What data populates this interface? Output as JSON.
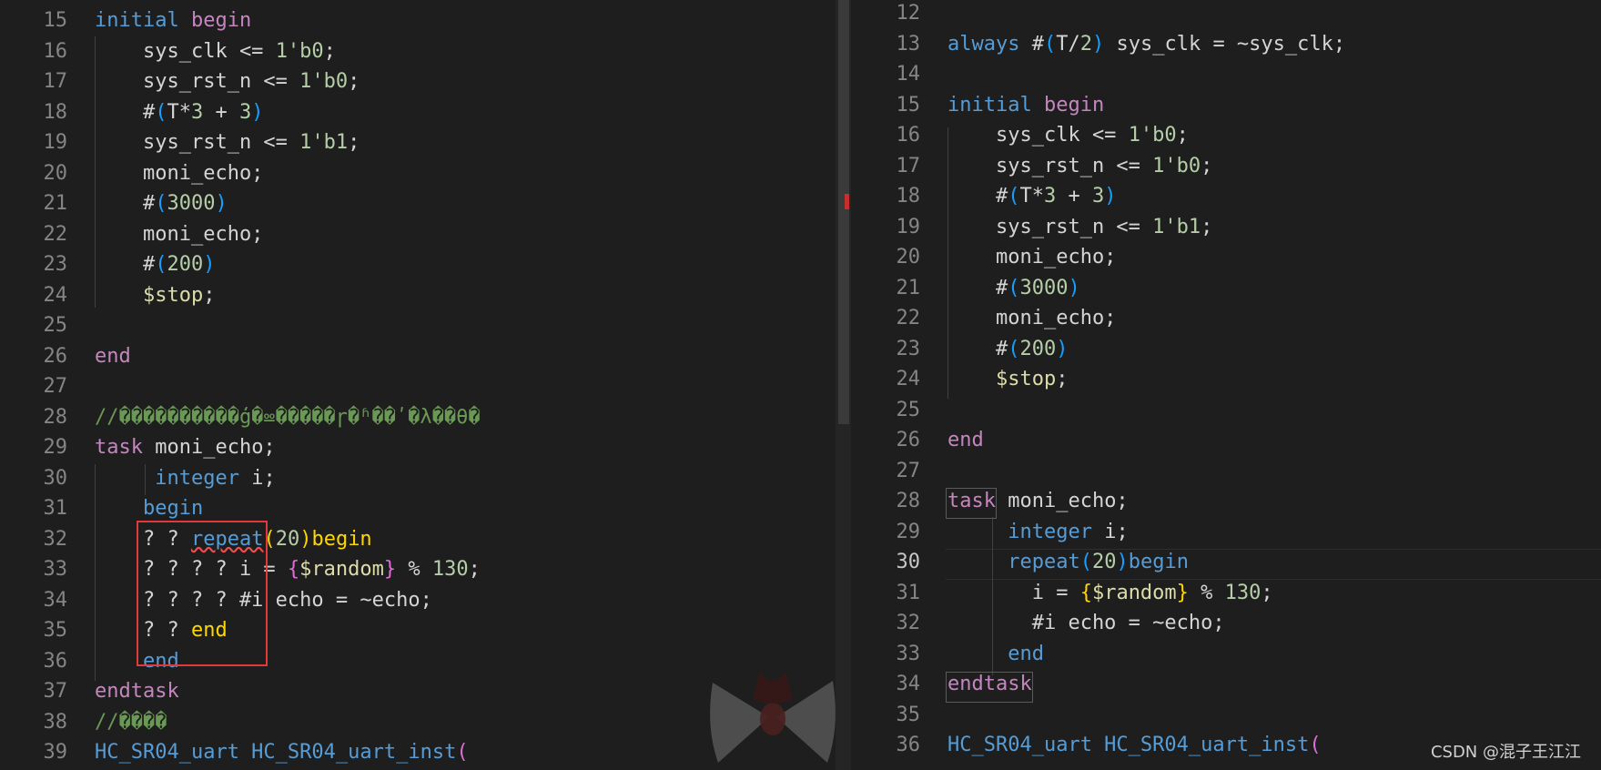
{
  "left": {
    "lines": [
      {
        "n": "15",
        "s": [
          [
            "initial",
            "kw"
          ],
          [
            " "
          ],
          [
            "begin",
            "kwp"
          ]
        ]
      },
      {
        "n": "16",
        "s": [
          [
            "    sys_clk <= "
          ],
          [
            "1'b0",
            "num"
          ],
          [
            ";"
          ]
        ]
      },
      {
        "n": "17",
        "s": [
          [
            "    sys_rst_n <= "
          ],
          [
            "1'b0",
            "num"
          ],
          [
            ";"
          ]
        ]
      },
      {
        "n": "18",
        "s": [
          [
            "    #"
          ],
          [
            "(",
            "br2"
          ],
          [
            "T*"
          ],
          [
            "3",
            "num"
          ],
          [
            " + "
          ],
          [
            "3",
            "num"
          ],
          [
            ")",
            "br2"
          ]
        ]
      },
      {
        "n": "19",
        "s": [
          [
            "    sys_rst_n <= "
          ],
          [
            "1'b1",
            "num"
          ],
          [
            ";"
          ]
        ]
      },
      {
        "n": "20",
        "s": [
          [
            "    moni_echo;"
          ]
        ]
      },
      {
        "n": "21",
        "s": [
          [
            "    #"
          ],
          [
            "(",
            "br2"
          ],
          [
            "3000",
            "num"
          ],
          [
            ")",
            "br2"
          ]
        ]
      },
      {
        "n": "22",
        "s": [
          [
            "    moni_echo;"
          ]
        ]
      },
      {
        "n": "23",
        "s": [
          [
            "    #"
          ],
          [
            "(",
            "br2"
          ],
          [
            "200",
            "num"
          ],
          [
            ")",
            "br2"
          ]
        ]
      },
      {
        "n": "24",
        "s": [
          [
            "    "
          ],
          [
            "$stop",
            "fn"
          ],
          [
            ";"
          ]
        ]
      },
      {
        "n": "25",
        "s": [
          [
            ""
          ]
        ]
      },
      {
        "n": "26",
        "s": [
          [
            "end",
            "kwp"
          ]
        ]
      },
      {
        "n": "27",
        "s": [
          [
            ""
          ]
        ]
      },
      {
        "n": "28",
        "s": [
          [
            "//����������ģ�ⳬ�����ɼ�ʱ��ʹ�λ��θ�",
            "cm"
          ]
        ]
      },
      {
        "n": "29",
        "s": [
          [
            "task",
            "kwp"
          ],
          [
            " moni_echo;"
          ]
        ]
      },
      {
        "n": "30",
        "s": [
          [
            "     "
          ],
          [
            "integer",
            "kw"
          ],
          [
            " i;"
          ]
        ]
      },
      {
        "n": "31",
        "s": [
          [
            "    "
          ],
          [
            "begin",
            "kw"
          ]
        ]
      },
      {
        "n": "32",
        "s": [
          [
            "    ? ? "
          ],
          [
            "repeat",
            "kw sq"
          ],
          [
            "(",
            "br1"
          ],
          [
            "20",
            "num"
          ],
          [
            ")",
            "br1"
          ],
          [
            "begin",
            "br1"
          ]
        ]
      },
      {
        "n": "33",
        "s": [
          [
            "    ? ? ? ? i = "
          ],
          [
            "{",
            "br3"
          ],
          [
            "$random",
            "fn"
          ],
          [
            "}",
            "br3"
          ],
          [
            " % "
          ],
          [
            "130",
            "num"
          ],
          [
            ";"
          ]
        ]
      },
      {
        "n": "34",
        "s": [
          [
            "    ? ? ? ? #i echo = ~echo;"
          ]
        ]
      },
      {
        "n": "35",
        "s": [
          [
            "    ? ? "
          ],
          [
            "end",
            "br1"
          ]
        ]
      },
      {
        "n": "36",
        "s": [
          [
            "    "
          ],
          [
            "end",
            "kw"
          ]
        ]
      },
      {
        "n": "37",
        "s": [
          [
            "endtask",
            "kwp"
          ]
        ]
      },
      {
        "n": "38",
        "s": [
          [
            "//����",
            "cm"
          ]
        ]
      },
      {
        "n": "39",
        "s": [
          [
            "HC_SR04_uart HC_SR04_uart_inst",
            "kw"
          ],
          [
            "(",
            "br3"
          ]
        ]
      }
    ]
  },
  "right": {
    "lines": [
      {
        "n": "12",
        "s": [
          [
            ""
          ]
        ]
      },
      {
        "n": "13",
        "s": [
          [
            "always",
            "kw"
          ],
          [
            " #"
          ],
          [
            "(",
            "br2"
          ],
          [
            "T/"
          ],
          [
            "2",
            "num"
          ],
          [
            ")",
            "br2"
          ],
          [
            " sys_clk = ~sys_clk;"
          ]
        ]
      },
      {
        "n": "14",
        "s": [
          [
            ""
          ]
        ]
      },
      {
        "n": "15",
        "s": [
          [
            "initial",
            "kw"
          ],
          [
            " "
          ],
          [
            "begin",
            "kwp"
          ]
        ]
      },
      {
        "n": "16",
        "s": [
          [
            "    sys_clk <= "
          ],
          [
            "1'b0",
            "num"
          ],
          [
            ";"
          ]
        ]
      },
      {
        "n": "17",
        "s": [
          [
            "    sys_rst_n <= "
          ],
          [
            "1'b0",
            "num"
          ],
          [
            ";"
          ]
        ]
      },
      {
        "n": "18",
        "s": [
          [
            "    #"
          ],
          [
            "(",
            "br2"
          ],
          [
            "T*"
          ],
          [
            "3",
            "num"
          ],
          [
            " + "
          ],
          [
            "3",
            "num"
          ],
          [
            ")",
            "br2"
          ]
        ]
      },
      {
        "n": "19",
        "s": [
          [
            "    sys_rst_n <= "
          ],
          [
            "1'b1",
            "num"
          ],
          [
            ";"
          ]
        ]
      },
      {
        "n": "20",
        "s": [
          [
            "    moni_echo;"
          ]
        ]
      },
      {
        "n": "21",
        "s": [
          [
            "    #"
          ],
          [
            "(",
            "br2"
          ],
          [
            "3000",
            "num"
          ],
          [
            ")",
            "br2"
          ]
        ]
      },
      {
        "n": "22",
        "s": [
          [
            "    moni_echo;"
          ]
        ]
      },
      {
        "n": "23",
        "s": [
          [
            "    #"
          ],
          [
            "(",
            "br2"
          ],
          [
            "200",
            "num"
          ],
          [
            ")",
            "br2"
          ]
        ]
      },
      {
        "n": "24",
        "s": [
          [
            "    "
          ],
          [
            "$stop",
            "fn"
          ],
          [
            ";"
          ]
        ]
      },
      {
        "n": "25",
        "s": [
          [
            ""
          ]
        ]
      },
      {
        "n": "26",
        "s": [
          [
            "end",
            "kwp"
          ]
        ]
      },
      {
        "n": "27",
        "s": [
          [
            ""
          ]
        ]
      },
      {
        "n": "28",
        "s": [
          [
            "task",
            "kwp"
          ],
          [
            " moni_echo;"
          ]
        ]
      },
      {
        "n": "29",
        "s": [
          [
            "     "
          ],
          [
            "integer",
            "kw"
          ],
          [
            " i;"
          ]
        ]
      },
      {
        "n": "30",
        "s": [
          [
            "     "
          ],
          [
            "repeat",
            "kw"
          ],
          [
            "(",
            "br2"
          ],
          [
            "20",
            "num"
          ],
          [
            ")",
            "br2"
          ],
          [
            "begin",
            "kw"
          ]
        ]
      },
      {
        "n": "31",
        "s": [
          [
            "       i = "
          ],
          [
            "{",
            "br1"
          ],
          [
            "$random",
            "fn"
          ],
          [
            "}",
            "br1"
          ],
          [
            " % "
          ],
          [
            "130",
            "num"
          ],
          [
            ";"
          ]
        ]
      },
      {
        "n": "32",
        "s": [
          [
            "       #i echo = ~echo;"
          ]
        ]
      },
      {
        "n": "33",
        "s": [
          [
            "     "
          ],
          [
            "end",
            "kw"
          ]
        ]
      },
      {
        "n": "34",
        "s": [
          [
            "endtask",
            "kwp"
          ]
        ]
      },
      {
        "n": "35",
        "s": [
          [
            ""
          ]
        ]
      },
      {
        "n": "36",
        "s": [
          [
            "HC_SR04_uart HC_SR04_uart_inst",
            "kw"
          ],
          [
            "(",
            "br3"
          ]
        ]
      }
    ],
    "active_line": "30"
  },
  "watermark": "CSDN @混子王江江",
  "colors": {
    "background": "#1e1e1e",
    "keyword": "#569cd6",
    "control": "#c586c0",
    "number": "#b5cea8",
    "comment": "#6a9955",
    "function": "#dcdcaa",
    "annotation": "#e03a3a"
  },
  "icons": [
    "bow-decoration"
  ]
}
